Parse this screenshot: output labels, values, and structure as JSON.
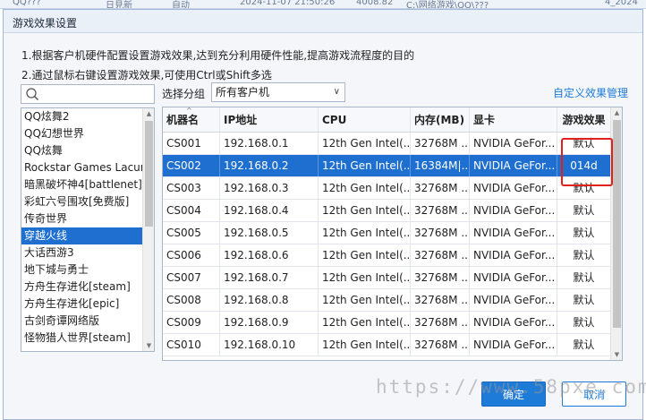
{
  "background_row": {
    "cells": [
      "QQ???",
      "日見新",
      "自动",
      "2024-11-07 21:50:26",
      "4008.82",
      "C:\\网络游戏\\QQ\\???",
      "4_2024"
    ]
  },
  "dialog": {
    "title": "游戏效果设置",
    "tip1": "1.根据客户机硬件配置设置游戏效果,达到充分利用硬件性能,提高游戏流程度的目的",
    "tip2": "2.通过鼠标右键设置游戏效果,可使用Ctrl或Shift多选"
  },
  "search": {
    "placeholder": ""
  },
  "games": [
    "QQ炫舞2",
    "QQ幻想世界",
    "QQ炫舞",
    "Rockstar Games Lacunl",
    "暗黑破坏神4[battlenet]",
    "彩虹六号围攻[免费版]",
    "传奇世界",
    "穿越火线",
    "大话西游3",
    "地下城与勇士",
    "方舟生存进化[steam]",
    "方舟生存进化[epic]",
    "古剑奇谭网络版",
    "怪物猎人世界[steam]"
  ],
  "selected_game_index": 7,
  "group": {
    "label": "选择分组",
    "value": "所有客户机"
  },
  "custom_link": "自定义效果管理",
  "grid": {
    "columns": [
      "机器名",
      "IP地址",
      "CPU",
      "内存(MB)",
      "显卡",
      "游戏效果"
    ],
    "selected_row_index": 1,
    "rows": [
      [
        "CS001",
        "192.168.0.1",
        "12th Gen Intel(...",
        "32768M ...",
        "NVIDIA GeFor...",
        "默认"
      ],
      [
        "CS002",
        "192.168.0.2",
        "12th Gen Intel(...",
        "16384M|...",
        "NVIDIA GeFor...",
        "014d"
      ],
      [
        "CS003",
        "192.168.0.3",
        "12th Gen Intel(...",
        "32768M ...",
        "NVIDIA GeFor...",
        "默认"
      ],
      [
        "CS004",
        "192.168.0.4",
        "12th Gen Intel(...",
        "32768M ...",
        "NVIDIA GeFor...",
        "默认"
      ],
      [
        "CS005",
        "192.168.0.5",
        "12th Gen Intel(...",
        "32768M ...",
        "NVIDIA GeFor...",
        "默认"
      ],
      [
        "CS006",
        "192.168.0.6",
        "12th Gen Intel(...",
        "32768M ...",
        "NVIDIA GeFor...",
        "默认"
      ],
      [
        "CS007",
        "192.168.0.7",
        "12th Gen Intel(...",
        "32768M ...",
        "NVIDIA GeFor...",
        "默认"
      ],
      [
        "CS008",
        "192.168.0.8",
        "12th Gen Intel(...",
        "32768M ...",
        "NVIDIA GeFor...",
        "默认"
      ],
      [
        "CS009",
        "192.168.0.9",
        "12th Gen Intel(...",
        "32768M ...",
        "NVIDIA GeFor...",
        "默认"
      ],
      [
        "CS010",
        "192.168.0.10",
        "12th Gen Intel(...",
        "32768M ...",
        "NVIDIA GeFor...",
        "默认"
      ]
    ]
  },
  "buttons": {
    "ok": "确定",
    "cancel": "取消"
  },
  "watermark": "https://www.58pxe.com",
  "colors": {
    "accent": "#1e7bd8",
    "selection": "#1e6fd0",
    "annotation": "#e0201a"
  }
}
